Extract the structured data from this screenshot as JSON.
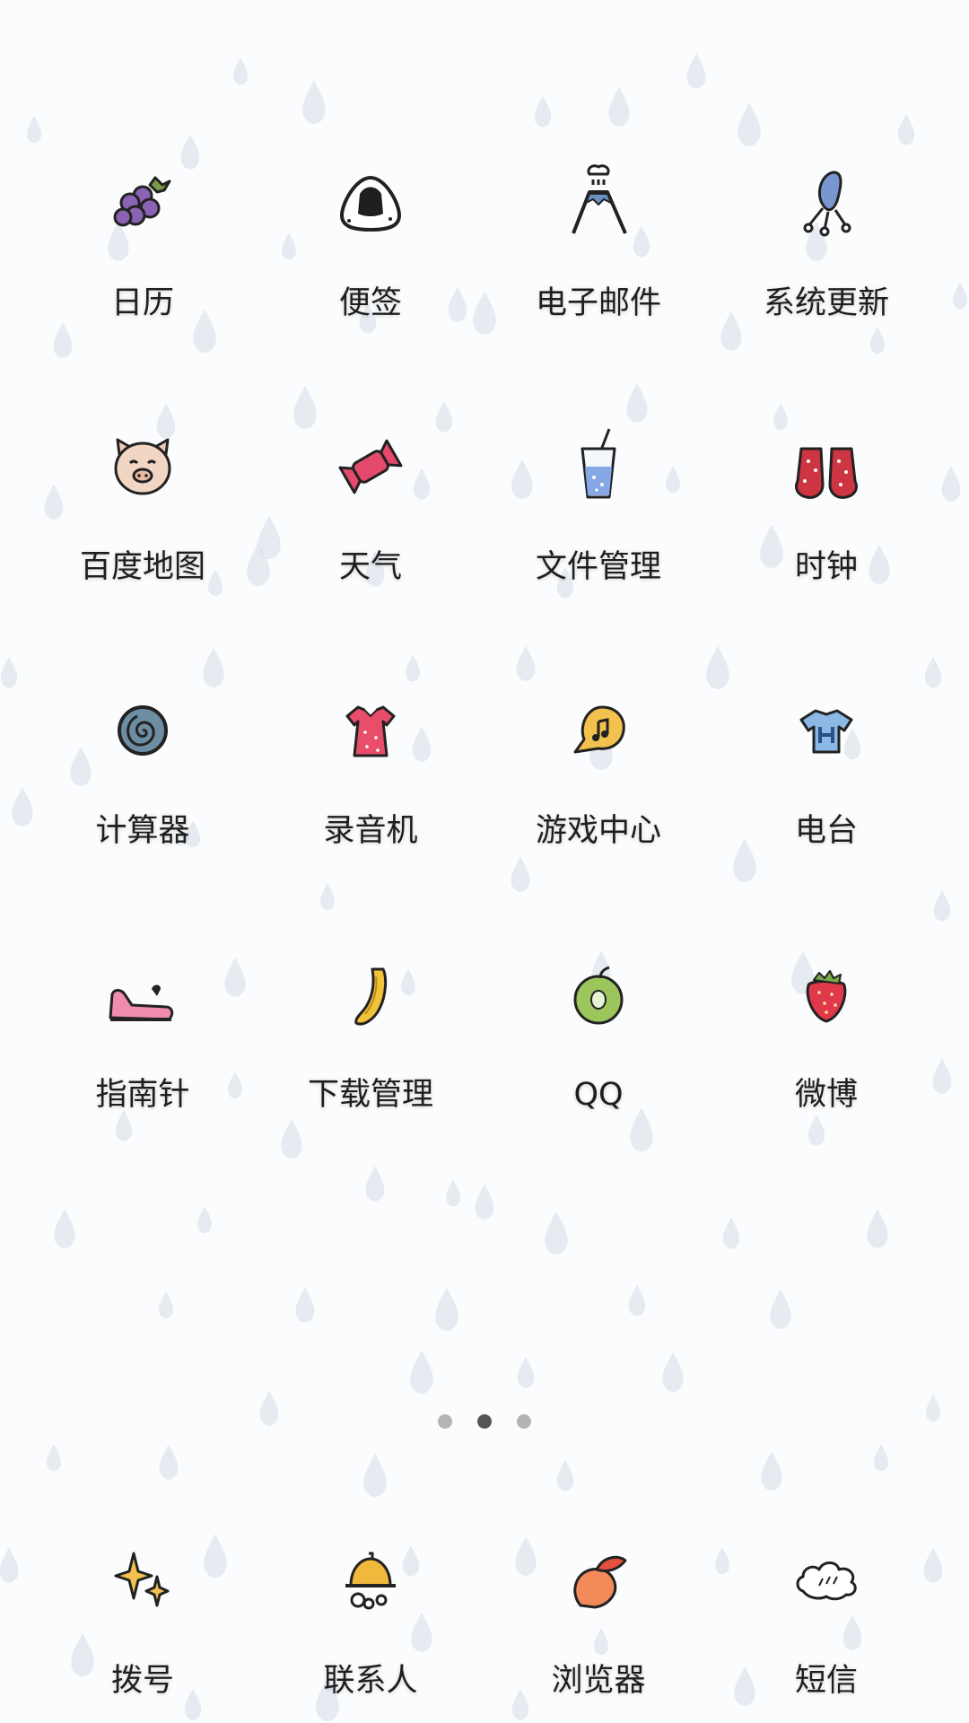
{
  "home": {
    "apps": [
      {
        "label": "日历",
        "icon": "grapes-icon"
      },
      {
        "label": "便签",
        "icon": "rice-ball-icon"
      },
      {
        "label": "电子邮件",
        "icon": "volcano-icon"
      },
      {
        "label": "系统更新",
        "icon": "chair-icon"
      },
      {
        "label": "百度地图",
        "icon": "pig-icon"
      },
      {
        "label": "天气",
        "icon": "candy-icon"
      },
      {
        "label": "文件管理",
        "icon": "drink-cup-icon"
      },
      {
        "label": "时钟",
        "icon": "socks-icon"
      },
      {
        "label": "计算器",
        "icon": "snail-shell-icon"
      },
      {
        "label": "录音机",
        "icon": "dress-icon"
      },
      {
        "label": "游戏中心",
        "icon": "music-bubble-icon"
      },
      {
        "label": "电台",
        "icon": "t-shirt-icon"
      },
      {
        "label": "指南针",
        "icon": "shoe-icon"
      },
      {
        "label": "下载管理",
        "icon": "banana-icon"
      },
      {
        "label": "QQ",
        "icon": "apple-icon"
      },
      {
        "label": "微博",
        "icon": "strawberry-icon"
      }
    ]
  },
  "pager": {
    "pages": 3,
    "current_page": 2
  },
  "dock": {
    "apps": [
      {
        "label": "拨号",
        "icon": "sparkle-icon"
      },
      {
        "label": "联系人",
        "icon": "bell-icon"
      },
      {
        "label": "浏览器",
        "icon": "peach-icon"
      },
      {
        "label": "短信",
        "icon": "cloud-icon"
      }
    ]
  },
  "colors": {
    "background": "#fbfcfd",
    "raindrop": "#dfe6ee",
    "label": "#1e1e1e",
    "dot_active": "#555555",
    "dot_inactive": "#b4b4b4"
  }
}
